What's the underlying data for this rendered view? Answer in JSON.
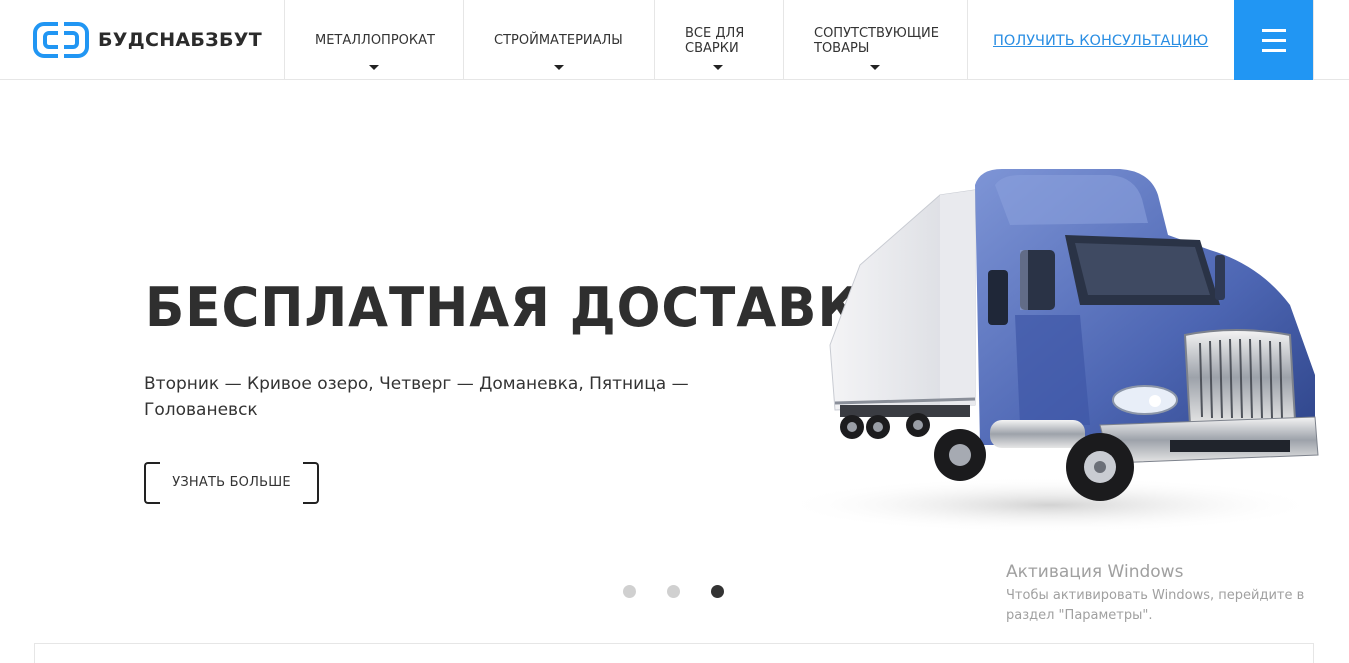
{
  "header": {
    "logo_text": "БУДСНАБЗБУТ",
    "nav": [
      {
        "line1": "МЕТАЛЛОПРОКАТ",
        "line2": ""
      },
      {
        "line1": "СТРОЙМАТЕРИАЛЫ",
        "line2": ""
      },
      {
        "line1": "ВСЕ ДЛЯ",
        "line2": "СВАРКИ"
      },
      {
        "line1": "СОПУТСТВУЮЩИЕ",
        "line2": "ТОВАРЫ"
      }
    ],
    "consult_link": "ПОЛУЧИТЬ КОНСУЛЬТАЦИЮ",
    "menu_icon": "hamburger-icon",
    "accent_color": "#2196f3"
  },
  "hero": {
    "title": "БЕСПЛАТНАЯ ДОСТАВКА",
    "subtitle": "Вторник — Кривое озеро, Четверг — Доманевка, Пятница — Голованевск",
    "button_label": "УЗНАТЬ БОЛЬШЕ",
    "image": "truck-image",
    "slides": [
      {
        "active": false
      },
      {
        "active": false
      },
      {
        "active": true
      }
    ]
  },
  "windows_watermark": {
    "title": "Активация Windows",
    "text": "Чтобы активировать Windows, перейдите в раздел \"Параметры\"."
  }
}
